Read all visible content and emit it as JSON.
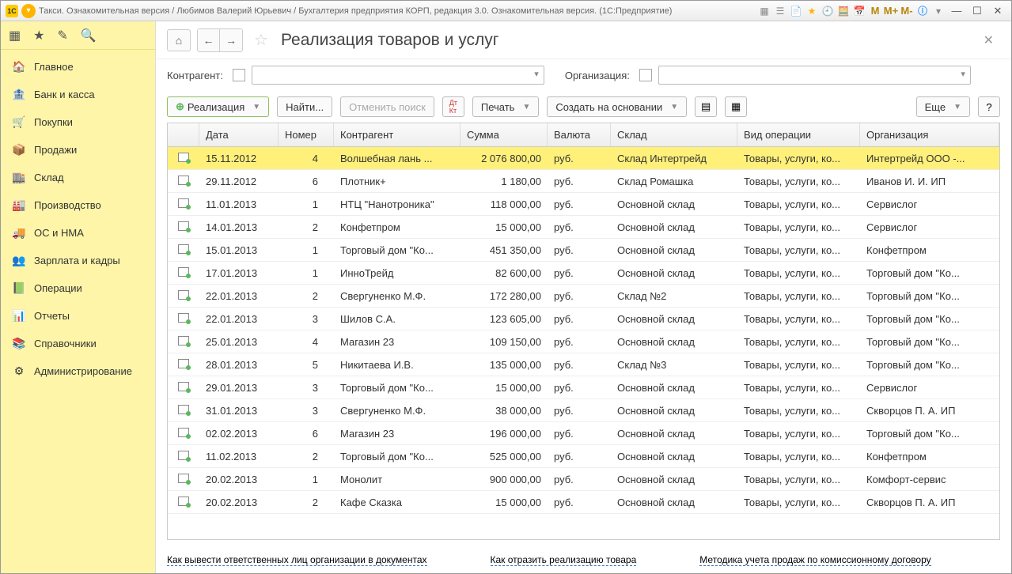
{
  "titlebar": {
    "title": "Такси. Ознакомительная версия / Любимов Валерий Юрьевич / Бухгалтерия предприятия КОРП, редакция 3.0. Ознакомительная версия.  (1С:Предприятие)",
    "m1": "M",
    "m2": "M+",
    "m3": "M-"
  },
  "sidebar": {
    "items": [
      {
        "icon": "🏠",
        "label": "Главное"
      },
      {
        "icon": "🏦",
        "label": "Банк и касса"
      },
      {
        "icon": "🛒",
        "label": "Покупки"
      },
      {
        "icon": "📦",
        "label": "Продажи"
      },
      {
        "icon": "🏬",
        "label": "Склад"
      },
      {
        "icon": "🏭",
        "label": "Производство"
      },
      {
        "icon": "🚚",
        "label": "ОС и НМА"
      },
      {
        "icon": "👥",
        "label": "Зарплата и кадры"
      },
      {
        "icon": "📗",
        "label": "Операции"
      },
      {
        "icon": "📊",
        "label": "Отчеты"
      },
      {
        "icon": "📚",
        "label": "Справочники"
      },
      {
        "icon": "⚙",
        "label": "Администрирование"
      }
    ]
  },
  "header": {
    "title": "Реализация товаров и услуг"
  },
  "filters": {
    "counterparty": "Контрагент:",
    "organization": "Организация:"
  },
  "toolbar": {
    "create": "Реализация",
    "find": "Найти...",
    "cancel": "Отменить поиск",
    "print": "Печать",
    "create_on": "Создать на основании",
    "more": "Еще",
    "help": "?"
  },
  "columns": {
    "date": "Дата",
    "num": "Номер",
    "con": "Контрагент",
    "sum": "Сумма",
    "cur": "Валюта",
    "wh": "Склад",
    "op": "Вид операции",
    "org": "Организация"
  },
  "rows": [
    {
      "date": "15.11.2012",
      "num": "4",
      "con": "Волшебная лань ...",
      "sum": "2 076 800,00",
      "cur": "руб.",
      "wh": "Склад Интертрейд",
      "op": "Товары, услуги, ко...",
      "org": "Интертрейд ООО -...",
      "sel": true
    },
    {
      "date": "29.11.2012",
      "num": "6",
      "con": "Плотник+",
      "sum": "1 180,00",
      "cur": "руб.",
      "wh": "Склад Ромашка",
      "op": "Товары, услуги, ко...",
      "org": "Иванов И. И. ИП"
    },
    {
      "date": "11.01.2013",
      "num": "1",
      "con": "НТЦ \"Нанотроника\"",
      "sum": "118 000,00",
      "cur": "руб.",
      "wh": "Основной склад",
      "op": "Товары, услуги, ко...",
      "org": "Сервислог"
    },
    {
      "date": "14.01.2013",
      "num": "2",
      "con": "Конфетпром",
      "sum": "15 000,00",
      "cur": "руб.",
      "wh": "Основной склад",
      "op": "Товары, услуги, ко...",
      "org": "Сервислог"
    },
    {
      "date": "15.01.2013",
      "num": "1",
      "con": "Торговый дом \"Ко...",
      "sum": "451 350,00",
      "cur": "руб.",
      "wh": "Основной склад",
      "op": "Товары, услуги, ко...",
      "org": "Конфетпром"
    },
    {
      "date": "17.01.2013",
      "num": "1",
      "con": "ИнноТрейд",
      "sum": "82 600,00",
      "cur": "руб.",
      "wh": "Основной склад",
      "op": "Товары, услуги, ко...",
      "org": "Торговый дом \"Ко..."
    },
    {
      "date": "22.01.2013",
      "num": "2",
      "con": "Свергуненко М.Ф.",
      "sum": "172 280,00",
      "cur": "руб.",
      "wh": "Склад №2",
      "op": "Товары, услуги, ко...",
      "org": "Торговый дом \"Ко..."
    },
    {
      "date": "22.01.2013",
      "num": "3",
      "con": "Шилов С.А.",
      "sum": "123 605,00",
      "cur": "руб.",
      "wh": "Основной склад",
      "op": "Товары, услуги, ко...",
      "org": "Торговый дом \"Ко..."
    },
    {
      "date": "25.01.2013",
      "num": "4",
      "con": "Магазин 23",
      "sum": "109 150,00",
      "cur": "руб.",
      "wh": "Основной склад",
      "op": "Товары, услуги, ко...",
      "org": "Торговый дом \"Ко..."
    },
    {
      "date": "28.01.2013",
      "num": "5",
      "con": "Никитаева И.В.",
      "sum": "135 000,00",
      "cur": "руб.",
      "wh": "Склад №3",
      "op": "Товары, услуги, ко...",
      "org": "Торговый дом \"Ко..."
    },
    {
      "date": "29.01.2013",
      "num": "3",
      "con": "Торговый дом \"Ко...",
      "sum": "15 000,00",
      "cur": "руб.",
      "wh": "Основной склад",
      "op": "Товары, услуги, ко...",
      "org": "Сервислог"
    },
    {
      "date": "31.01.2013",
      "num": "3",
      "con": "Свергуненко М.Ф.",
      "sum": "38 000,00",
      "cur": "руб.",
      "wh": "Основной склад",
      "op": "Товары, услуги, ко...",
      "org": "Скворцов П. А. ИП"
    },
    {
      "date": "02.02.2013",
      "num": "6",
      "con": "Магазин 23",
      "sum": "196 000,00",
      "cur": "руб.",
      "wh": "Основной склад",
      "op": "Товары, услуги, ко...",
      "org": "Торговый дом \"Ко..."
    },
    {
      "date": "11.02.2013",
      "num": "2",
      "con": "Торговый дом \"Ко...",
      "sum": "525 000,00",
      "cur": "руб.",
      "wh": "Основной склад",
      "op": "Товары, услуги, ко...",
      "org": "Конфетпром"
    },
    {
      "date": "20.02.2013",
      "num": "1",
      "con": "Монолит",
      "sum": "900 000,00",
      "cur": "руб.",
      "wh": "Основной склад",
      "op": "Товары, услуги, ко...",
      "org": "Комфорт-сервис"
    },
    {
      "date": "20.02.2013",
      "num": "2",
      "con": "Кафе Сказка",
      "sum": "15 000,00",
      "cur": "руб.",
      "wh": "Основной склад",
      "op": "Товары, услуги, ко...",
      "org": "Скворцов П. А. ИП"
    }
  ],
  "links": {
    "a": "Как вывести ответственных лиц организации в документах",
    "b": "Как отразить реализацию товара",
    "c": "Методика учета продаж по комиссионному договору"
  }
}
